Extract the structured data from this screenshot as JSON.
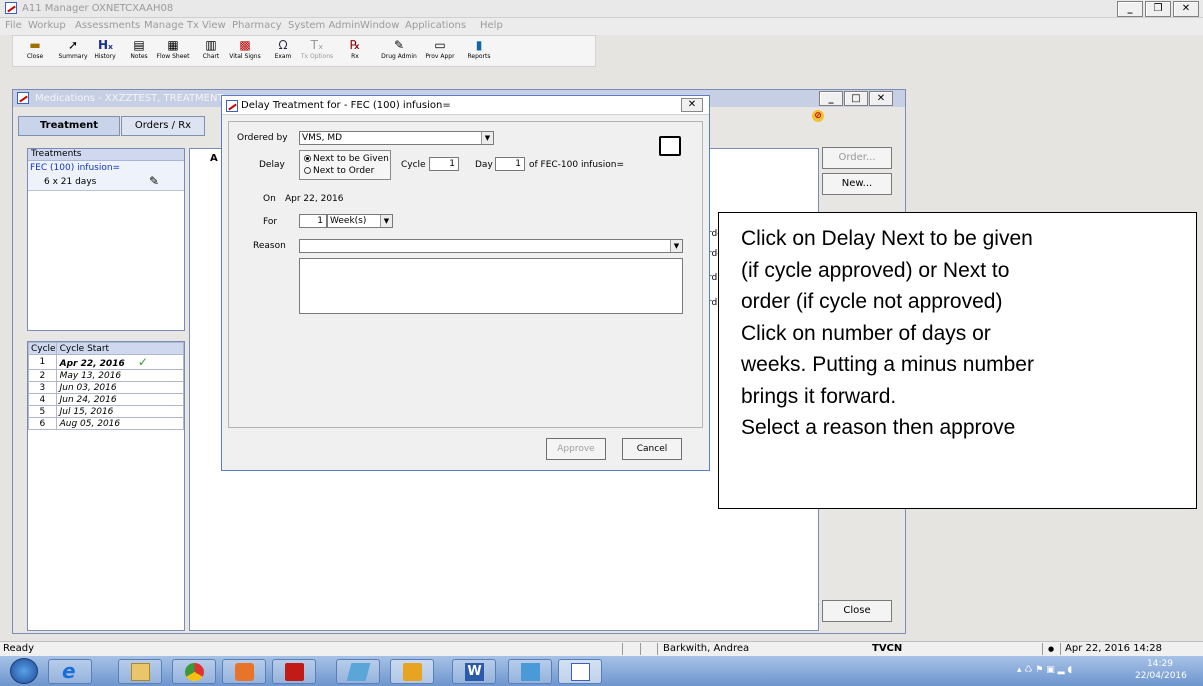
{
  "main_window": {
    "title": "A11 Manager OXNETCXAAH08"
  },
  "menu": [
    "File",
    "Workup",
    "Assessments",
    "Manage Tx",
    "View",
    "Pharmacy",
    "System Admin",
    "Window",
    "Applications",
    "Help"
  ],
  "toolbar": [
    {
      "label": "Close",
      "icon": "door-icon"
    },
    {
      "label": "Summary",
      "icon": "arrow-icon"
    },
    {
      "label": "History",
      "icon": "hx-icon"
    },
    {
      "label": "Notes",
      "icon": "notes-icon"
    },
    {
      "label": "Flow Sheet",
      "icon": "grid-icon"
    },
    {
      "label": "Chart",
      "icon": "chart-icon"
    },
    {
      "label": "Vital Signs",
      "icon": "vitals-icon"
    },
    {
      "label": "Exam",
      "icon": "stethoscope-icon"
    },
    {
      "label": "Tx Options",
      "icon": "tx-icon"
    },
    {
      "label": "Rx",
      "icon": "rx-icon"
    },
    {
      "label": "Drug Admin",
      "icon": "drug-icon"
    },
    {
      "label": "Prov Appr",
      "icon": "approve-icon"
    },
    {
      "label": "Reports",
      "icon": "reports-icon"
    }
  ],
  "med_window": {
    "title": "Medications - XXZZTEST, TREATMENT",
    "tabs": [
      "Treatment",
      "Orders / Rx"
    ],
    "treatments_header": "Treatments",
    "treatment_name": "FEC (100) infusion=",
    "treatment_sched": "6 x 21 days",
    "cycle_headers": [
      "Cycle",
      "Cycle Start"
    ],
    "cycles": [
      {
        "n": "1",
        "start": "Apr 22, 2016"
      },
      {
        "n": "2",
        "start": "May 13, 2016"
      },
      {
        "n": "3",
        "start": "Jun 03, 2016"
      },
      {
        "n": "4",
        "start": "Jun 24, 2016"
      },
      {
        "n": "5",
        "start": "Jul 15, 2016"
      },
      {
        "n": "6",
        "start": "Aug 05, 2016"
      }
    ],
    "col_frag": "A",
    "ordered_labels": [
      "rdered",
      "rdered",
      "rd",
      "rd"
    ],
    "buttons": {
      "order": "Order...",
      "new": "New...",
      "close": "Close"
    }
  },
  "dialog": {
    "title": "Delay Treatment for - FEC (100) infusion=",
    "ordered_by_label": "Ordered by",
    "ordered_by": "VMS, MD",
    "delay_label": "Delay",
    "radio_next_given": "Next to be Given",
    "radio_next_order": "Next to Order",
    "cycle_label": "Cycle",
    "cycle_value": "1",
    "day_label": "Day",
    "day_value": "1",
    "of_text": "of  FEC-100 infusion=",
    "on_label": "On",
    "on_value": "Apr 22, 2016",
    "for_label": "For",
    "for_value": "1",
    "unit": "Week(s)",
    "reason_label": "Reason",
    "reason_value": "",
    "notes": "",
    "approve": "Approve",
    "cancel": "Cancel"
  },
  "callout": [
    "Click on Delay Next to be given",
    "(if cycle approved) or Next to",
    "order (if cycle not approved)",
    "Click on number of days or",
    "weeks. Putting a minus number",
    "brings it forward.",
    "Select a reason then approve"
  ],
  "status": {
    "ready": "Ready",
    "user": "Barkwith, Andrea",
    "site": "TVCN",
    "datetime": "Apr 22, 2016 14:28"
  },
  "tray": {
    "time": "14:29",
    "date": "22/04/2016"
  },
  "colors": {
    "accent": "#3b62b8",
    "panel_header": "#cfd8ee"
  }
}
